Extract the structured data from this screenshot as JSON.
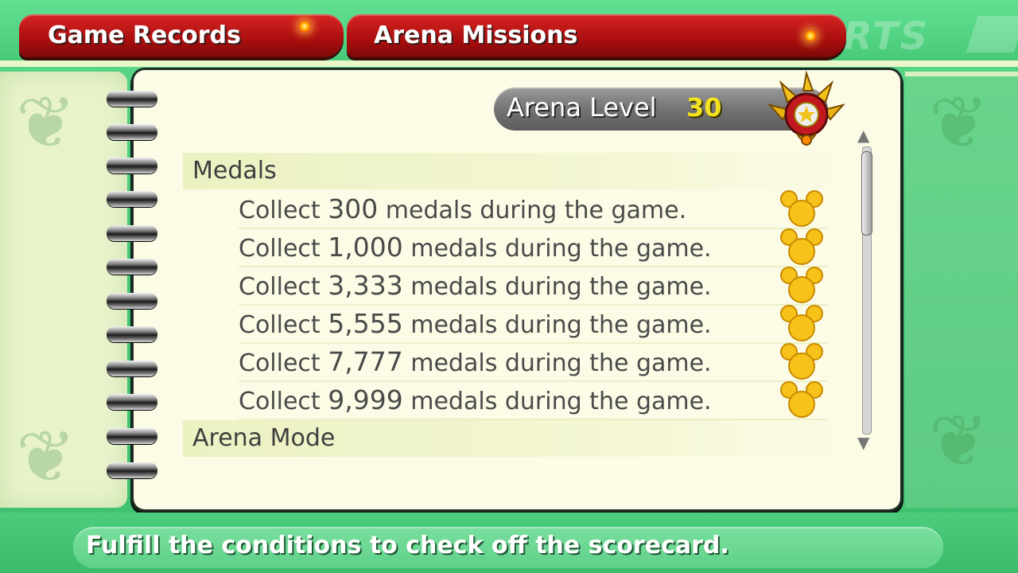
{
  "tabs": [
    {
      "label": "Game Records"
    },
    {
      "label": "Arena Missions"
    }
  ],
  "background_text": "RTS",
  "arena_level": {
    "label": "Arena Level",
    "value": "30"
  },
  "sections": {
    "medals": {
      "title": "Medals",
      "missions": [
        {
          "prefix": "Collect ",
          "number": "300",
          "suffix": " medals during the game.",
          "completed": true
        },
        {
          "prefix": "Collect ",
          "number": "1,000",
          "suffix": " medals during the game.",
          "completed": true
        },
        {
          "prefix": "Collect ",
          "number": "3,333",
          "suffix": " medals during the game.",
          "completed": true
        },
        {
          "prefix": "Collect ",
          "number": "5,555",
          "suffix": " medals during the game.",
          "completed": true
        },
        {
          "prefix": "Collect ",
          "number": "7,777",
          "suffix": " medals during the game.",
          "completed": true
        },
        {
          "prefix": "Collect ",
          "number": "9,999",
          "suffix": " medals during the game.",
          "completed": true
        }
      ]
    },
    "arena_mode": {
      "title": "Arena Mode"
    }
  },
  "help_text": "Fulfill the conditions to check off the scorecard.",
  "icons": {
    "emblem": "crown-emblem-icon",
    "check": "mickey-check-icon",
    "scroll_up": "scroll-up-arrow-icon",
    "scroll_down": "scroll-down-arrow-icon"
  },
  "colors": {
    "tab_red": "#b01212",
    "background_green": "#46c877",
    "panel_cream": "#fbfbe6",
    "level_yellow": "#f3e21f",
    "mickey_gold": "#f7c21a"
  }
}
